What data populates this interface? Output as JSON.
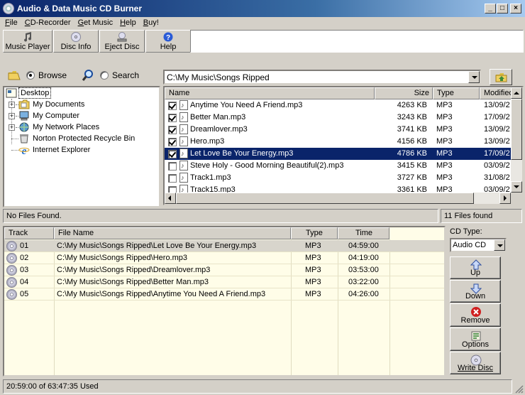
{
  "window": {
    "title": "Audio & Data Music CD Burner",
    "controls": {
      "minimize": "_",
      "maximize": "□",
      "close": "×"
    }
  },
  "menu": [
    {
      "label": "File",
      "u": "F",
      "rest": "ile"
    },
    {
      "label": "CD-Recorder",
      "u": "C",
      "rest": "D-Recorder"
    },
    {
      "label": "Get Music",
      "u": "G",
      "rest": "et Music"
    },
    {
      "label": "Help",
      "u": "H",
      "rest": "elp"
    },
    {
      "label": "Buy!",
      "u": "B",
      "rest": "uy!"
    }
  ],
  "toolbar": {
    "music_player": "Music Player",
    "disc_info": "Disc Info",
    "eject_disc": "Eject Disc",
    "help": "Help"
  },
  "mode": {
    "browse": "Browse",
    "search": "Search",
    "selected": "browse"
  },
  "tree": {
    "root": "Desktop",
    "items": [
      "My Documents",
      "My Computer",
      "My Network Places",
      "Norton Protected Recycle Bin",
      "Internet Explorer"
    ]
  },
  "path": "C:\\My Music\\Songs Ripped",
  "files": {
    "columns": {
      "name": "Name",
      "size": "Size",
      "type": "Type",
      "modified": "Modified"
    },
    "rows": [
      {
        "checked": true,
        "name": "Anytime You Need A Friend.mp3",
        "size": "4263 KB",
        "type": "MP3",
        "modified": "13/09/2"
      },
      {
        "checked": true,
        "name": "Better Man.mp3",
        "size": "3243 KB",
        "type": "MP3",
        "modified": "17/09/2"
      },
      {
        "checked": true,
        "name": "Dreamlover.mp3",
        "size": "3741 KB",
        "type": "MP3",
        "modified": "13/09/2"
      },
      {
        "checked": true,
        "name": "Hero.mp3",
        "size": "4156 KB",
        "type": "MP3",
        "modified": "13/09/2"
      },
      {
        "checked": true,
        "name": "Let Love Be Your Energy.mp3",
        "size": "4786 KB",
        "type": "MP3",
        "modified": "17/09/2",
        "selected": true
      },
      {
        "checked": false,
        "name": "Steve Holy - Good Morning Beautiful(2).mp3",
        "size": "3415 KB",
        "type": "MP3",
        "modified": "03/09/2"
      },
      {
        "checked": false,
        "name": "Track1.mp3",
        "size": "3727 KB",
        "type": "MP3",
        "modified": "31/08/2"
      },
      {
        "checked": false,
        "name": "Track15.mp3",
        "size": "3361 KB",
        "type": "MP3",
        "modified": "03/09/2"
      }
    ]
  },
  "status": {
    "left": "No Files Found.",
    "right": "11 Files found"
  },
  "tracks": {
    "columns": {
      "track": "Track",
      "file": "File Name",
      "type": "Type",
      "time": "Time"
    },
    "rows": [
      {
        "track": "01",
        "file": "C:\\My Music\\Songs Ripped\\Let Love Be Your Energy.mp3",
        "type": "MP3",
        "time": "04:59:00"
      },
      {
        "track": "02",
        "file": "C:\\My Music\\Songs Ripped\\Hero.mp3",
        "type": "MP3",
        "time": "04:19:00"
      },
      {
        "track": "03",
        "file": "C:\\My Music\\Songs Ripped\\Dreamlover.mp3",
        "type": "MP3",
        "time": "03:53:00"
      },
      {
        "track": "04",
        "file": "C:\\My Music\\Songs Ripped\\Better Man.mp3",
        "type": "MP3",
        "time": "03:22:00"
      },
      {
        "track": "05",
        "file": "C:\\My Music\\Songs Ripped\\Anytime You Need A Friend.mp3",
        "type": "MP3",
        "time": "04:26:00"
      }
    ]
  },
  "cd": {
    "type_label": "CD Type:",
    "type_value": "Audio CD",
    "up": "Up",
    "down": "Down",
    "remove": "Remove",
    "options": "Options",
    "write": "Write Disc"
  },
  "usage": "20:59:00 of 63:47:35 Used",
  "colors": {
    "selection": "#0a246a",
    "tracklist_bg": "#fffde8",
    "face": "#d4d0c8"
  }
}
